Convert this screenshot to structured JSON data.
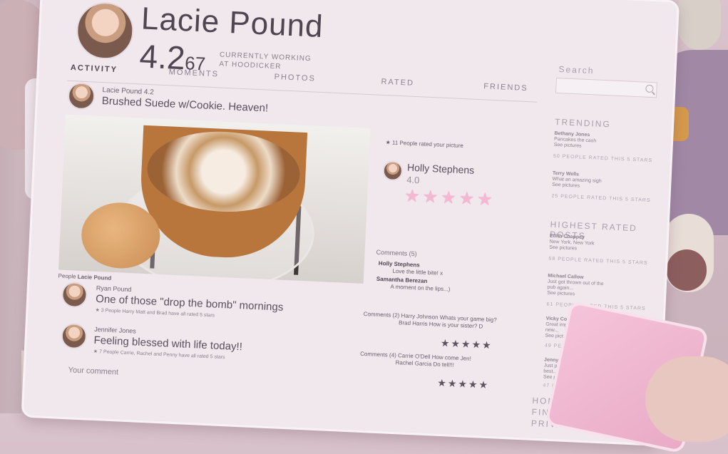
{
  "profile": {
    "name": "Lacie Pound",
    "score_main": "4.2",
    "score_decimals": "67",
    "work_line1": "CURRENTLY WORKING",
    "work_line2": "AT HOODICKER"
  },
  "tabs": [
    "ACTIVITY",
    "MOMENTS",
    "PHOTOS",
    "RATED",
    "FRIENDS"
  ],
  "search": {
    "label": "Search",
    "placeholder": ""
  },
  "post": {
    "author": "Lacie Pound 4.2",
    "text": "Brushed Suede w/Cookie. Heaven!",
    "photo_caption_label": "People",
    "photo_caption_name": "Lacie Pound",
    "rated_line": "11 People rated your picture",
    "rater": {
      "name": "Holly Stephens",
      "score": "4.0",
      "stars": "★★★★★"
    },
    "comments_title": "Comments (5)",
    "comments": [
      {
        "name": "Holly Stephens",
        "text": "Love the little bite! x"
      },
      {
        "name": "Samantha Berezan",
        "text": "A moment on the lips...)"
      }
    ]
  },
  "feed": [
    {
      "name": "Ryan Pound",
      "text": "One of those \"drop the bomb\" mornings",
      "meta": "★ 3 People   Harry Matt and Brad have all rated 5 stars",
      "comments_label": "Comments (2)",
      "comment1": "Harry Johnson  Whats your game big?",
      "comment2": "Brad Harris  How is your sister? D",
      "stars": "★★★★★"
    },
    {
      "name": "Jennifer Jones",
      "text": "Feeling blessed with life today!!",
      "meta": "★ 7 People   Carrie, Rachel and Penny have all rated 5 stars",
      "comments_label": "Comments (4)",
      "comment1": "Carrie O'Dell  How come Jen!",
      "comment2": "Rachel Garcia  Do tell!!!",
      "stars": "★★★★★"
    }
  ],
  "comment_input": {
    "placeholder": "Your comment"
  },
  "sidebar": {
    "trending_title": "TRENDING",
    "trending": [
      {
        "name": "Bethany Jones",
        "line1": "Pancakes the cash",
        "line2": "See pictures",
        "rating": "50 PEOPLE RATED THIS 5 STARS"
      },
      {
        "name": "Terry Wells",
        "line1": "What an amazing sigh",
        "line2": "See pictures",
        "rating": "25 PEOPLE RATED THIS 5 STARS"
      }
    ],
    "highest_title": "HIGHEST RATED POSTS",
    "highest": [
      {
        "name": "Edith Chappey",
        "line1": "New York, New York",
        "line2": "See pictures",
        "rating": "58 PEOPLE RATED THIS 5 STARS"
      },
      {
        "name": "Michael Callow",
        "line1": "Just got thrown out of the",
        "line2": "pub again...",
        "line3": "See pictures",
        "rating": "61 PEOPLE RATED THIS 5 STARS"
      },
      {
        "name": "Vicky Connor",
        "line1": "Great impressions with my",
        "line2": "new...",
        "line3": "See pictures",
        "rating": "49 PEOPLE RATED THIS 5"
      },
      {
        "name": "Jenny Grace",
        "line1": "Just pushed up my",
        "line2": "best...",
        "line3": "See pictures",
        "rating": "47 PEOPLE RATED"
      }
    ],
    "nav": [
      "HOME",
      "FIND FRI",
      "PRIVAC"
    ]
  }
}
